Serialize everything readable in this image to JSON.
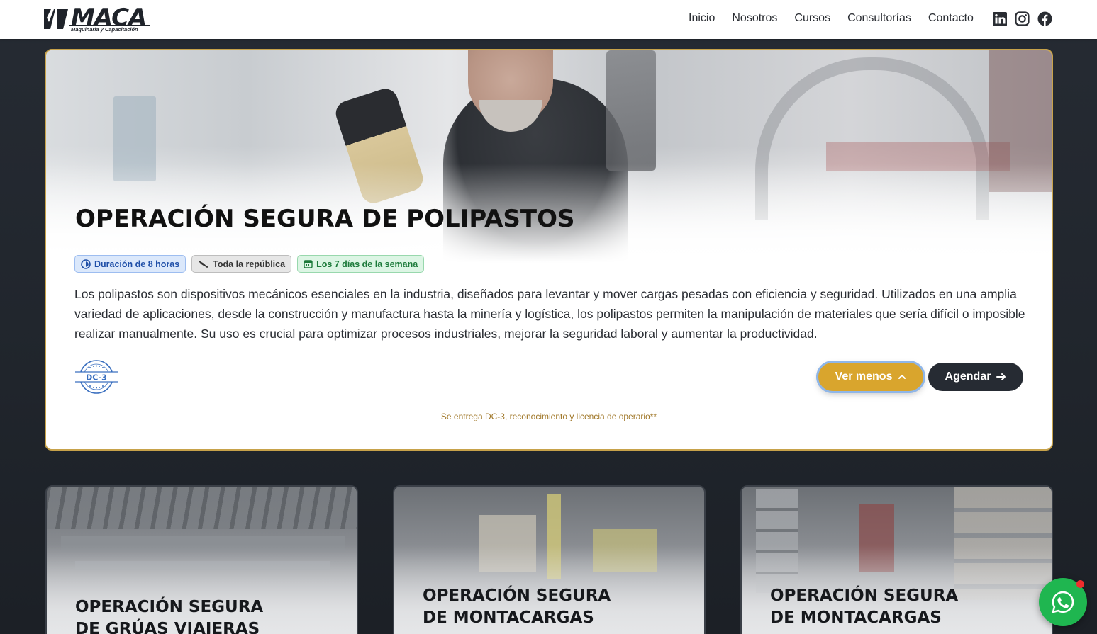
{
  "brand": {
    "name": "MACA",
    "tagline": "Maquinaria y Capacitación"
  },
  "nav": {
    "items": [
      {
        "label": "Inicio"
      },
      {
        "label": "Nosotros"
      },
      {
        "label": "Cursos"
      },
      {
        "label": "Consultorías"
      },
      {
        "label": "Contacto"
      }
    ],
    "socials": [
      "linkedin-icon",
      "instagram-icon",
      "facebook-icon"
    ]
  },
  "featured_course": {
    "title": "OPERACIÓN SEGURA DE POLIPASTOS",
    "badges": [
      {
        "label": "Duración de 8 horas",
        "icon": "clock-icon",
        "color": "#1f4fa8"
      },
      {
        "label": "Toda la república",
        "icon": "map-icon",
        "color": "#333333"
      },
      {
        "label": "Los 7 días de la semana",
        "icon": "calendar-icon",
        "color": "#1c7a3a"
      }
    ],
    "description": "Los polipastos son dispositivos mecánicos esenciales en la industria, diseñados para levantar y mover cargas pesadas con eficiencia y seguridad. Utilizados en una amplia variedad de aplicaciones, desde la construcción y manufactura hasta la minería y logística, los polipastos permiten la manipulación de materiales que sería difícil o imposible realizar manualmente. Su uso es crucial para optimizar procesos industriales, mejorar la seguridad laboral y aumentar la productividad.",
    "seal_text": "DC-3",
    "less_button": "Ver menos",
    "schedule_button": "Agendar",
    "footnote": "Se entrega DC-3, reconocimiento y licencia de operario**"
  },
  "courses": [
    {
      "title": "OPERACIÓN SEGURA DE GRÚAS VIAJERAS"
    },
    {
      "title": "OPERACIÓN SEGURA DE MONTACARGAS"
    },
    {
      "title": "OPERACIÓN SEGURA DE MONTACARGAS"
    }
  ],
  "colors": {
    "accent": "#d9a52d",
    "dark": "#262b33",
    "whatsapp": "#1fb650"
  }
}
